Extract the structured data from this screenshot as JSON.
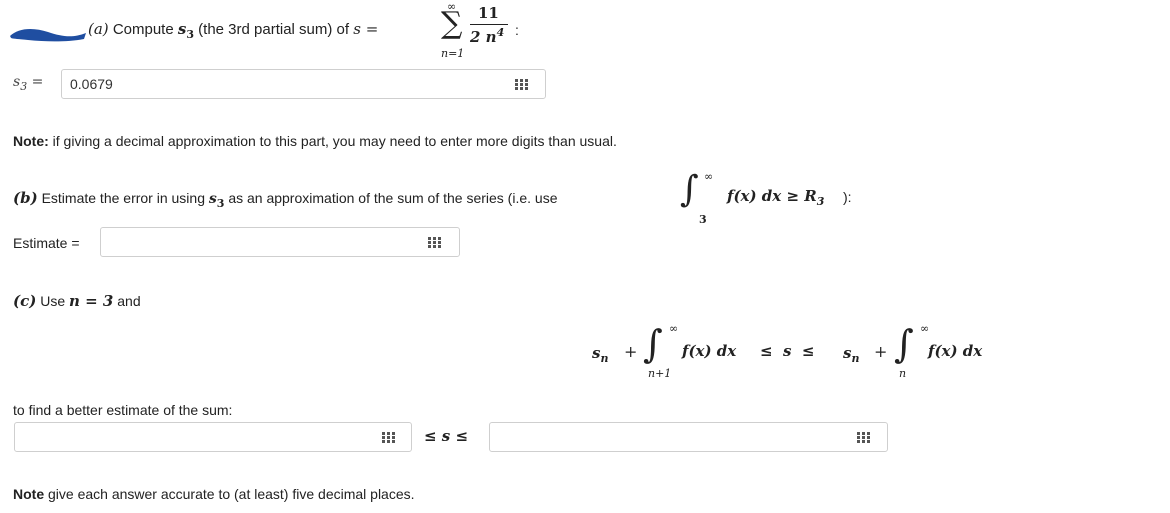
{
  "part_a": {
    "label": "(a)",
    "text": "Compute",
    "s3_symbol": "s",
    "s3_sub": "3",
    "paren": "(the 3rd partial sum) of",
    "s_eq": "s =",
    "sum_top": "∞",
    "sum_bottom": "n=1",
    "frac_num": "11",
    "frac_den_base": "2 n",
    "frac_den_exp": "4",
    "colon": ":",
    "answer_label_s": "s",
    "answer_label_sub": "3",
    "answer_label_eq": "=",
    "answer_value": "0.0679"
  },
  "note1": {
    "bold": "Note:",
    "text": " if giving a decimal approximation to this part, you may need to enter more digits than usual."
  },
  "part_b": {
    "label": "(b)",
    "text1": "Estimate the error in using",
    "s": "s",
    "sub": "3",
    "text2": "as an approximation of the sum of the series (i.e. use",
    "int_top": "∞",
    "int_bottom": "3",
    "integrand": "f(x) dx ≥ R",
    "r_sub": "3",
    "close": "):",
    "estimate_label": "Estimate =",
    "estimate_value": ""
  },
  "part_c": {
    "label": "(c)",
    "text_use": "Use",
    "n_eq": "n = 3",
    "text_and": "and",
    "formula_sn": "s",
    "formula_n": "n",
    "plus": "+",
    "int1_top": "∞",
    "int1_bottom": "n+1",
    "fx": "f(x) dx",
    "leq_s_leq": "≤  s  ≤",
    "int2_top": "∞",
    "int2_bottom": "n",
    "find_text": "to find a better estimate of the sum:",
    "lower_value": "",
    "upper_value": "",
    "between": "≤ s ≤"
  },
  "note2": {
    "bold": "Note",
    "text": " give each answer accurate to (at least) five decimal places."
  },
  "icons": [
    "keypad-icon"
  ]
}
